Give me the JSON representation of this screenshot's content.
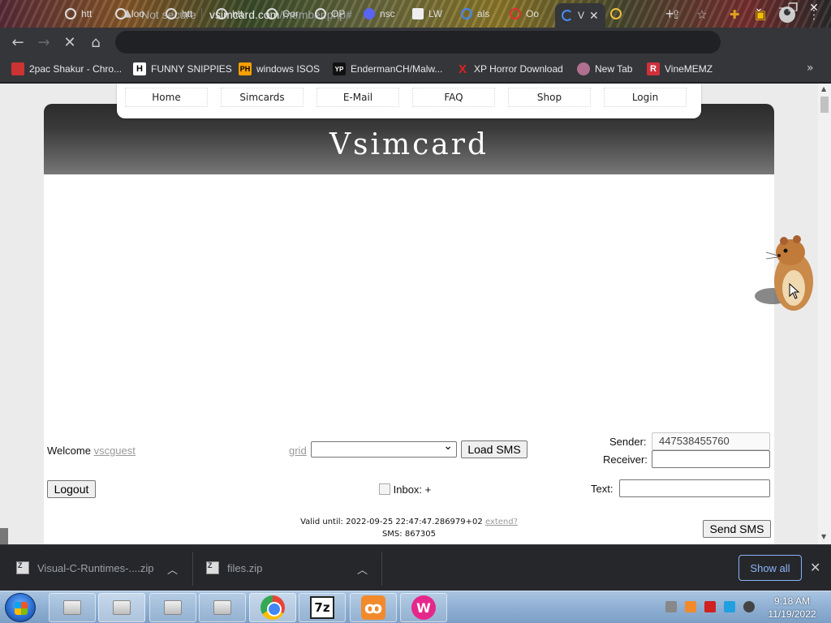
{
  "browser": {
    "tabs": [
      {
        "label": "htt"
      },
      {
        "label": "loo"
      },
      {
        "label": "htt"
      },
      {
        "label": "htt"
      },
      {
        "label": "Oor"
      },
      {
        "label": "OP"
      },
      {
        "label": "nsc"
      },
      {
        "label": "LW"
      },
      {
        "label": "als"
      },
      {
        "label": "Oo"
      },
      {
        "label": "V",
        "active": true
      }
    ],
    "new_tab_symbol": "+",
    "security_label": "Not secure",
    "url_host": "vsimcard.com",
    "url_path": "/member.php#",
    "bookmarks": [
      {
        "label": "2pac Shakur - Chro...",
        "icon": "bookmark-favicon"
      },
      {
        "label": "FUNNY SNIPPIES",
        "icon": "H"
      },
      {
        "label": "windows ISOS",
        "icon": "PH"
      },
      {
        "label": "EndermanCH/Malw...",
        "icon": "YP"
      },
      {
        "label": "XP Horror Download",
        "icon": "X"
      },
      {
        "label": "New Tab",
        "icon": "globe"
      },
      {
        "label": "VineMEMZ",
        "icon": "R"
      }
    ],
    "bookmarks_overflow": "»"
  },
  "site": {
    "nav": [
      "Home",
      "Simcards",
      "E-Mail",
      "FAQ",
      "Shop",
      "Login"
    ],
    "title": "Vsimcard",
    "welcome_label": "Welcome",
    "username": "vscguest",
    "grid_label": "grid",
    "grid_select_value": "",
    "load_sms_label": "Load SMS",
    "sender_label": "Sender:",
    "sender_value": "447538455760",
    "receiver_label": "Receiver:",
    "receiver_value": "",
    "logout_label": "Logout",
    "inbox_label": "Inbox:",
    "inbox_plus": "+",
    "text_label": "Text:",
    "text_value": "",
    "valid_until_label": "Valid until:",
    "valid_until_value": "2022-09-25 22:47:47.286979+02",
    "extend_label": "extend?",
    "sms_label": "SMS:",
    "sms_value": "867305",
    "send_sms_label": "Send SMS"
  },
  "downloads": {
    "items": [
      {
        "name": "Visual-C-Runtimes-....zip"
      },
      {
        "name": "files.zip"
      }
    ],
    "show_all_label": "Show all"
  },
  "taskbar": {
    "time": "9:18 AM",
    "date": "11/19/2022"
  },
  "colors": {
    "link": "#999999",
    "show_all_accent": "#8ab4f8",
    "banner_dark": "#2c2c2c"
  }
}
